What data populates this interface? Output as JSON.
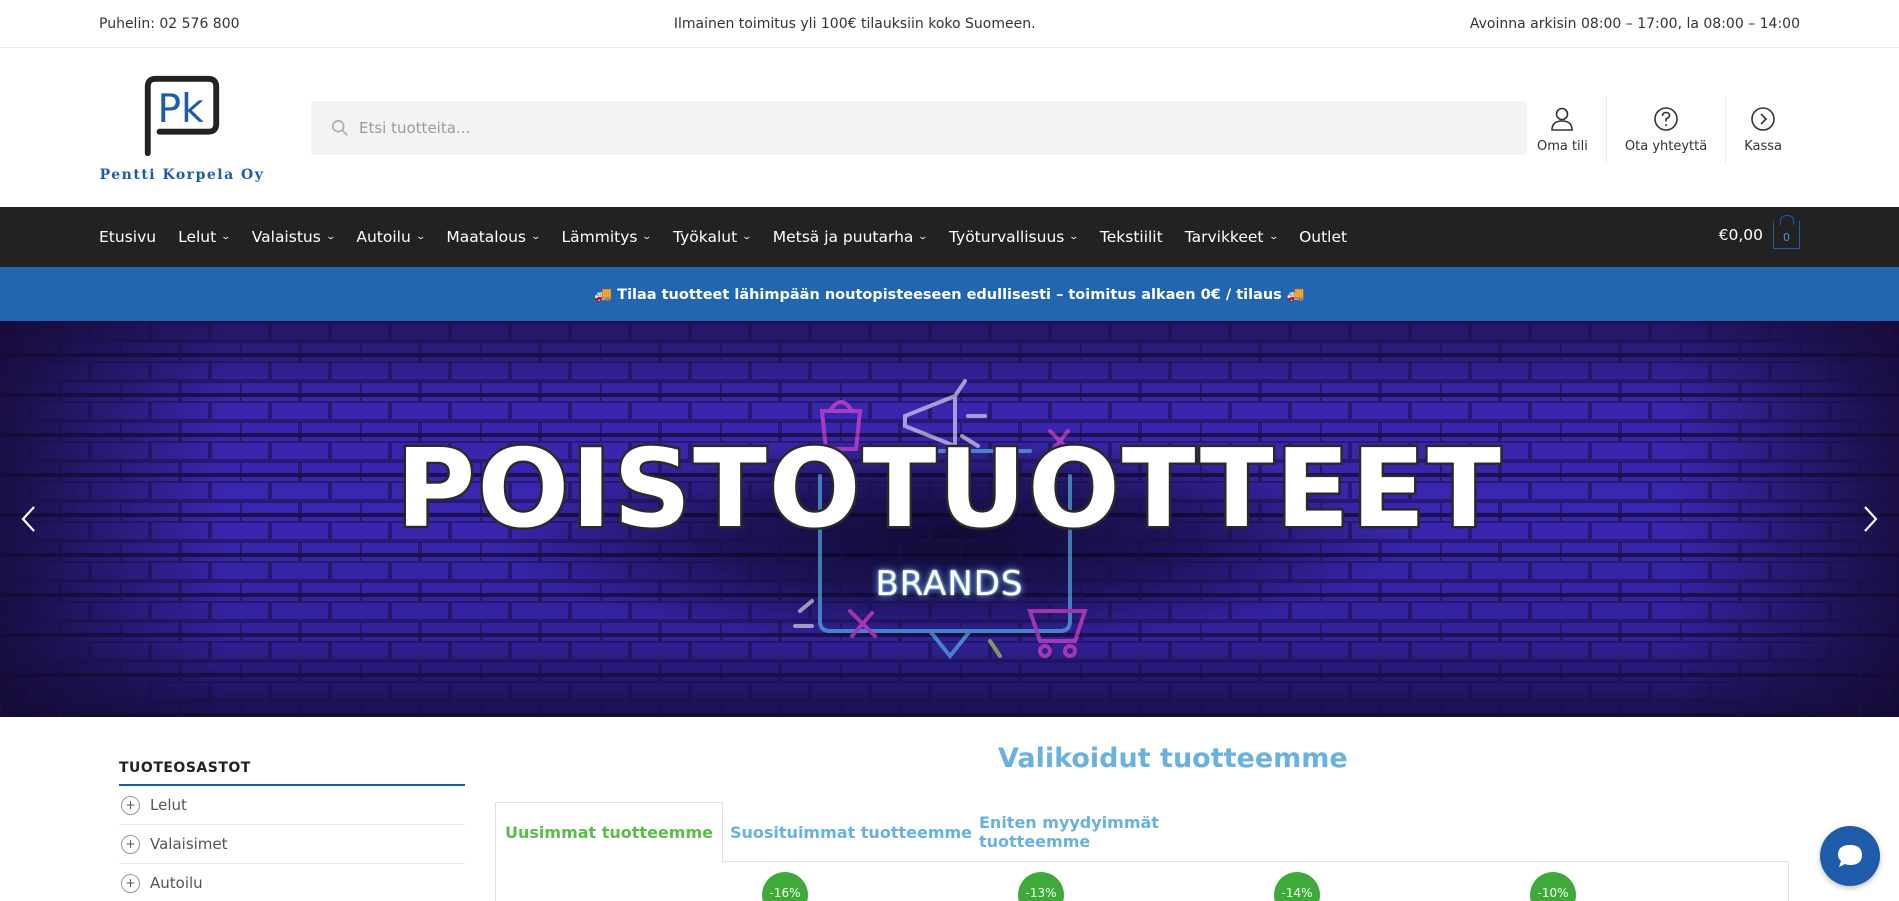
{
  "topbar": {
    "phone": "Puhelin: 02 576 800",
    "shipping": "Ilmainen toimitus yli 100€ tilauksiin koko Suomeen.",
    "hours": "Avoinna arkisin 08:00 – 17:00, la 08:00 – 14:00"
  },
  "logo": {
    "text": "Pentti Korpela Oy",
    "monogram": "Pk"
  },
  "search": {
    "placeholder": "Etsi tuotteita...",
    "value": ""
  },
  "header_links": [
    {
      "label": "Oma tili",
      "icon": "user-icon"
    },
    {
      "label": "Ota yhteyttä",
      "icon": "help-circle-icon"
    },
    {
      "label": "Kassa",
      "icon": "arrow-circle-right-icon"
    }
  ],
  "nav": {
    "items": [
      {
        "label": "Etusivu",
        "dropdown": false
      },
      {
        "label": "Lelut",
        "dropdown": true
      },
      {
        "label": "Valaistus",
        "dropdown": true
      },
      {
        "label": "Autoilu",
        "dropdown": true
      },
      {
        "label": "Maatalous",
        "dropdown": true
      },
      {
        "label": "Lämmitys",
        "dropdown": true
      },
      {
        "label": "Työkalut",
        "dropdown": true
      },
      {
        "label": "Metsä ja puutarha",
        "dropdown": true
      },
      {
        "label": "Työturvallisuus",
        "dropdown": true
      },
      {
        "label": "Tekstiilit",
        "dropdown": false
      },
      {
        "label": "Tarvikkeet",
        "dropdown": true
      },
      {
        "label": "Outlet",
        "dropdown": false
      }
    ],
    "cart_total": "€0,00",
    "cart_count": "0"
  },
  "promo": {
    "text": "🚚 Tilaa tuotteet lähimpään noutopisteeseen edullisesti – toimitus alkaen 0€ / tilaus 🚚"
  },
  "hero": {
    "title": "POISTOTUOTTEET",
    "subtitle": "BRANDS"
  },
  "sidebar": {
    "title": "TUOTEOSASTOT",
    "items": [
      "Lelut",
      "Valaisimet",
      "Autoilu"
    ]
  },
  "featured": {
    "title": "Valikoidut tuotteemme",
    "tabs": [
      "Uusimmat tuotteemme",
      "Suosituimmat tuotteemme",
      "Eniten myydyimmät tuotteemme"
    ],
    "active_tab": "Uusimmat tuotteemme",
    "badges": [
      "-16%",
      "-13%",
      "-14%",
      "-10%"
    ]
  },
  "colors": {
    "brand_blue": "#1e5ba8",
    "nav_bg": "#222222",
    "promo_bg": "#2266b0",
    "accent_light_blue": "#6ab2de",
    "active_green": "#5cbd4a",
    "badge_green": "#3daa3a"
  }
}
